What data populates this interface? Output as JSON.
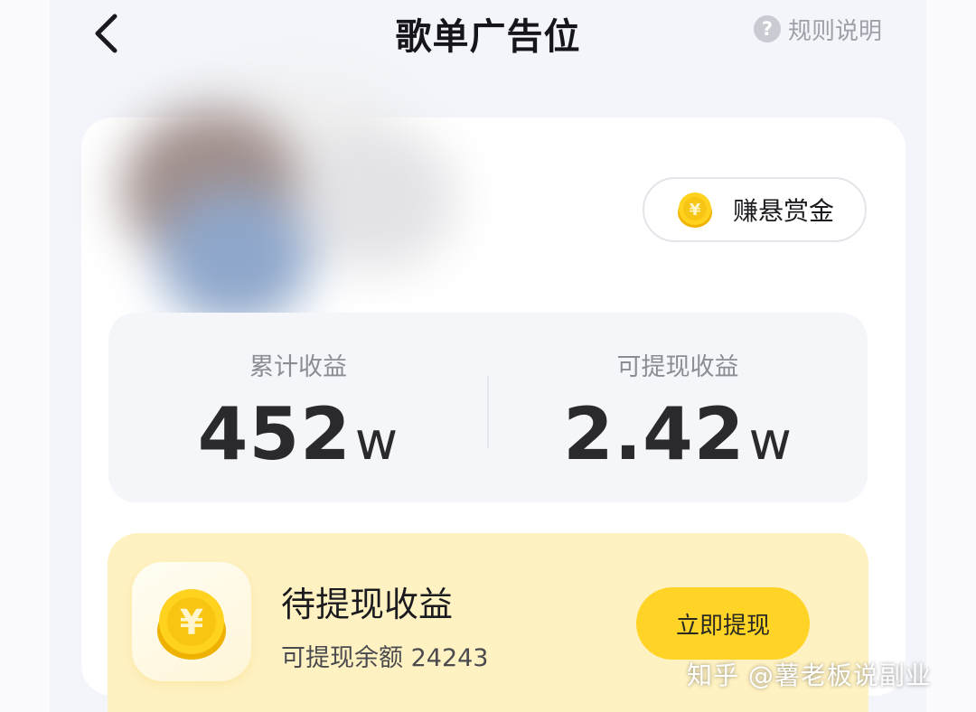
{
  "header": {
    "title": "歌单广告位",
    "rules_label": "规则说明",
    "help_icon_glyph": "?"
  },
  "bounty": {
    "label": "赚悬赏金",
    "coin_symbol": "¥"
  },
  "stats": {
    "total": {
      "label": "累计收益",
      "value": "452",
      "unit": "w"
    },
    "withdrawable": {
      "label": "可提现收益",
      "value": "2.42",
      "unit": "w"
    }
  },
  "withdraw": {
    "title": "待提现收益",
    "balance_text": "可提现余额 24243",
    "button_label": "立即提现",
    "coin_symbol": "¥"
  },
  "watermark": "知乎 @薯老板说副业",
  "colors": {
    "accent_yellow": "#ffd426",
    "withdraw_bg": "#fff2c2",
    "coin": "#f6c40c"
  }
}
